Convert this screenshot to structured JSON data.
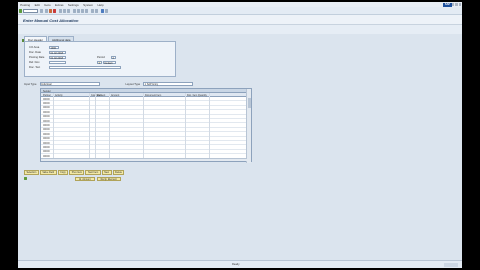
{
  "menubar": {
    "items": [
      "Posting",
      "Edit",
      "Goto",
      "Extras",
      "Settings",
      "System",
      "Help"
    ],
    "logo": "SAP"
  },
  "title": "Enter Manual Cost Allocation",
  "tabs": [
    "Doc.Header",
    "Additional data"
  ],
  "header": {
    "co_area_label": "CO Area",
    "co_area_value": "1000",
    "doc_date_label": "Doc. Date",
    "doc_date_value": "01.02.2018",
    "posting_date_label": "Posting Date",
    "posting_date_value": "01.02.2018",
    "ref_doc_label": "Ref. Doc.",
    "doc_text_label": "Doc. Text",
    "period_label": "Period",
    "period_value": "2",
    "ledger_label": "1",
    "ledger_value": "Default"
  },
  "row_bar": {
    "input_type_label": "Input Type",
    "input_type_value": "Individual",
    "layout_label": "Layout Type",
    "layout_value": "1 SAP Entry"
  },
  "grid": {
    "group_label": "Sender",
    "columns": [
      "Partner",
      "Activity",
      "Cost Element",
      "Curr",
      "Amount",
      "Document Item",
      "Doc. Item Quantity"
    ],
    "row_label": "00000",
    "row_count": 14
  },
  "bottom_buttons": [
    "Selection",
    "Value Field",
    "Copy",
    "Prev Item",
    "Next Item",
    "New",
    "Delete"
  ],
  "bottom_buttons2": [
    "Al. Amount",
    "Recip. Element"
  ],
  "status": "Ready"
}
